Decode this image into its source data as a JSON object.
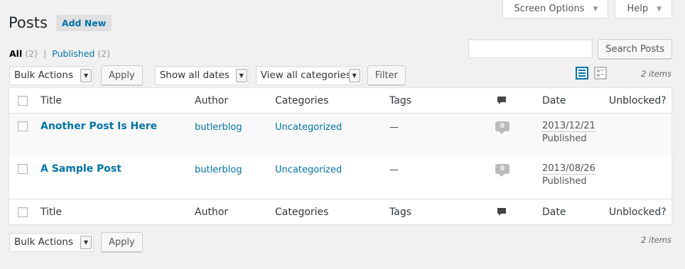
{
  "screen_meta": {
    "screen_options": "Screen Options",
    "help": "Help"
  },
  "page": {
    "title": "Posts",
    "add_new": "Add New"
  },
  "views": {
    "all_label": "All",
    "all_count": "(2)",
    "separator": "|",
    "published_label": "Published",
    "published_count": "(2)"
  },
  "search": {
    "value": "",
    "button": "Search Posts"
  },
  "filters": {
    "bulk_actions": "Bulk Actions",
    "apply": "Apply",
    "dates": "Show all dates",
    "categories": "View all categories",
    "filter": "Filter"
  },
  "items_count": "2 items",
  "columns": {
    "title": "Title",
    "author": "Author",
    "categories": "Categories",
    "tags": "Tags",
    "date": "Date",
    "unblocked": "Unblocked?"
  },
  "posts": [
    {
      "title": "Another Post Is Here",
      "author": "butlerblog",
      "category": "Uncategorized",
      "tags": "—",
      "comments": "0",
      "date": "2013/12/21",
      "status": "Published"
    },
    {
      "title": "A Sample Post",
      "author": "butlerblog",
      "category": "Uncategorized",
      "tags": "—",
      "comments": "0",
      "date": "2013/08/26",
      "status": "Published"
    }
  ],
  "bottom": {
    "bulk_actions": "Bulk Actions",
    "apply": "Apply",
    "items_count": "2 items"
  },
  "icons": {
    "list_view": "list-view-icon",
    "excerpt_view": "excerpt-view-icon",
    "comments": "comment-bubble-icon",
    "dropdown": "chevron-down-icon"
  },
  "colors": {
    "link": "#0073aa",
    "background": "#f1f1f1",
    "table_bg": "#ffffff"
  }
}
